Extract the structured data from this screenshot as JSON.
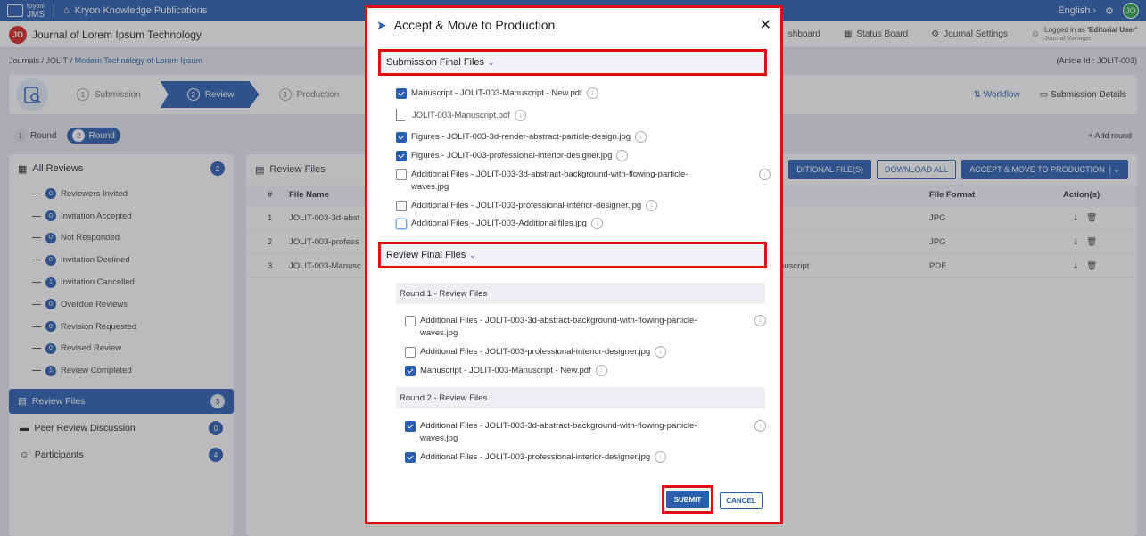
{
  "topbar": {
    "logo_small": "Kryoni",
    "logo_text": "JMS",
    "publication": "Kryon Knowledge Publications",
    "language": "English",
    "avatar": "JO"
  },
  "journalbar": {
    "avatar": "JO",
    "title": "Journal of Lorem Ipsum Technology",
    "nav": [
      "shboard",
      "Status Board",
      "Journal Settings"
    ],
    "logged_prefix": "Logged in as",
    "logged_role": "'Editorial User'",
    "logged_sub": "Journal Manager"
  },
  "breadcrumb": {
    "items": [
      "Journals",
      "JOLIT",
      "Modern Technology of Lorem Ipsum"
    ],
    "article_id": "(Article Id : JOLIT-003)"
  },
  "stepper": {
    "steps": [
      {
        "num": "1",
        "label": "Submission"
      },
      {
        "num": "2",
        "label": "Review"
      },
      {
        "num": "3",
        "label": "Production"
      }
    ],
    "workflow": "Workflow",
    "details": "Submission Details"
  },
  "rounds": {
    "tabs": [
      {
        "num": "1",
        "label": "Round"
      },
      {
        "num": "2",
        "label": "Round"
      }
    ],
    "add": "+ Add round"
  },
  "sidebar": {
    "all_reviews": "All Reviews",
    "all_count": "2",
    "sub": [
      {
        "count": "0",
        "label": "Reviewers Invited"
      },
      {
        "count": "0",
        "label": "Invitation Accepted"
      },
      {
        "count": "0",
        "label": "Not Responded"
      },
      {
        "count": "0",
        "label": "Invitation Declined"
      },
      {
        "count": "1",
        "label": "Invitation Cancelled"
      },
      {
        "count": "0",
        "label": "Overdue Reviews"
      },
      {
        "count": "0",
        "label": "Revision Requested"
      },
      {
        "count": "0",
        "label": "Revised Review"
      },
      {
        "count": "1",
        "label": "Review Completed"
      }
    ],
    "items": [
      {
        "label": "Review Files",
        "count": "3"
      },
      {
        "label": "Peer Review Discussion",
        "count": "0"
      },
      {
        "label": "Participants",
        "count": "4"
      }
    ]
  },
  "main": {
    "title": "Review Files",
    "btn_additional": "DITIONAL FILE(S)",
    "btn_download": "DOWNLOAD ALL",
    "btn_accept": "ACCEPT & MOVE TO PRODUCTION",
    "columns": [
      "#",
      "File Name",
      "",
      "File Format",
      "Action(s)"
    ],
    "rows": [
      {
        "num": "1",
        "name": "JOLIT-003-3d-abst",
        "extra": "",
        "format": "JPG"
      },
      {
        "num": "2",
        "name": "JOLIT-003-profess",
        "extra": "",
        "format": "JPG"
      },
      {
        "num": "3",
        "name": "JOLIT-003-Manusc",
        "extra": "nuscript",
        "format": "PDF"
      }
    ]
  },
  "modal": {
    "title": "Accept & Move to Production",
    "submission_title": "Submission Final Files",
    "submission_files": [
      "Manuscript - JOLIT-003-Manuscript - New.pdf",
      "JOLIT-003-Manuscript.pdf",
      "Figures - JOLIT-003-3d-render-abstract-particle-design.jpg",
      "Figures - JOLIT-003-professional-interior-designer.jpg",
      "Additional Files - JOLIT-003-3d-abstract-background-with-flowing-particle-waves.jpg",
      "Additional Files - JOLIT-003-professional-interior-designer.jpg",
      "Additional Files - JOLIT-003-Additional files.jpg"
    ],
    "review_title": "Review Final Files",
    "round1_title": "Round 1 - Review Files",
    "round1_files": [
      "Additional Files - JOLIT-003-3d-abstract-background-with-flowing-particle-waves.jpg",
      "Additional Files - JOLIT-003-professional-interior-designer.jpg",
      "Manuscript - JOLIT-003-Manuscript - New.pdf"
    ],
    "round2_title": "Round 2 - Review Files",
    "round2_files": [
      "Additional Files - JOLIT-003-3d-abstract-background-with-flowing-particle-waves.jpg",
      "Additional Files - JOLIT-003-professional-interior-designer.jpg"
    ],
    "submit": "SUBMIT",
    "cancel": "CANCEL"
  },
  "colors": {
    "brand": "#2a5fb0",
    "highlight": "#e00f14",
    "jo_badge": "#d9261c"
  }
}
